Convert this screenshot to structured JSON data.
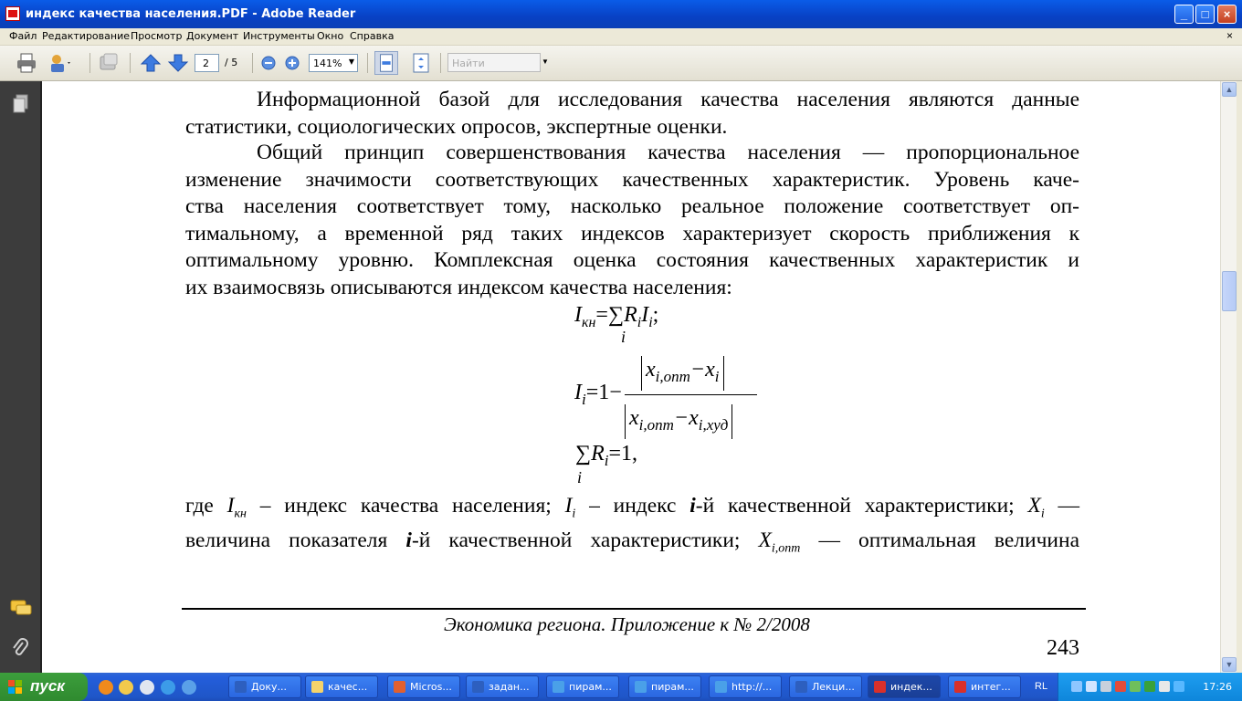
{
  "window": {
    "title": "индекс качества населения.PDF - Adobe Reader",
    "controls": {
      "minimize": "_",
      "maximize": "□",
      "close": "×"
    }
  },
  "menu": {
    "items": [
      "Файл",
      "Редактирование",
      "Просмотр",
      "Документ",
      "Инструменты",
      "Окно",
      "Справка"
    ],
    "close_doc": "×"
  },
  "toolbar": {
    "page_current": "2",
    "page_total": "/ 5",
    "zoom": "141%",
    "search_placeholder": "Найти"
  },
  "document": {
    "top_paragraph": [
      "Информационной базой для исследования качества населения являются данные",
      "статистики, социологических опросов, экспертные оценки."
    ],
    "main_paragraph": [
      "Общий принцип совершенствования качества населения — пропорциональное",
      "изменение значимости соответствующих качественных характеристик. Уровень каче-",
      "ства  населения соответствует тому, насколько реальное положение соответствует оп-",
      "тимальному, а временной ряд таких индексов характеризует скорость приближения к",
      "оптимальному уровню. Комплексная оценка состояния качественных характеристик и",
      "их взаимосвязь описываются индексом качества населения:"
    ],
    "formulas": {
      "f1_left": "I",
      "f1_left_sub": "кн",
      "f1_eq": "=",
      "f1_sum": "∑",
      "f1_sum_sub": "i",
      "f1_R": "R",
      "f1_R_sub": "i",
      "f1_I": "I",
      "f1_I_sub": "i",
      "f1_end": ";",
      "f2_left": "I",
      "f2_left_sub": "i",
      "f2_eq": "=1−",
      "f2_num": "x",
      "f2_num_sub": "i,опт",
      "f2_num_minus": "−x",
      "f2_num_minus_sub": "i",
      "f2_den": "x",
      "f2_den_sub": "i,опт",
      "f2_den_minus": "−x",
      "f2_den_minus_sub": "i,худ",
      "f3_sum": "∑",
      "f3_sum_sub": "i",
      "f3_R": "R",
      "f3_R_sub": "i",
      "f3_rest": "=1,"
    },
    "bottom_lines": {
      "l1_prefix": "где ",
      "l1_Ikn": "I",
      "l1_Ikn_sub": "кн",
      "l1_mid1": " – индекс качества  населения; ",
      "l1_Ii": "I",
      "l1_Ii_sub": "i",
      "l1_mid2": " – индекс ",
      "l1_i": "i",
      "l1_mid3": "-й качественной характеристики; ",
      "l1_Xi": "X",
      "l1_Xi_sub": "i",
      "l1_end": " —",
      "l2_a": "величина показателя ",
      "l2_i": "i",
      "l2_b": "-й качественной характеристики; ",
      "l2_X": "X",
      "l2_X_sub": "i,опт",
      "l2_c": " — оптимальная величина"
    },
    "footer": "Экономика региона. Приложение к № 2/2008",
    "page_number": "243"
  },
  "taskbar": {
    "start_label": "пуск",
    "tasks": [
      "Доку...",
      "качес...",
      "Micros...",
      "задан...",
      "пирам...",
      "пирам...",
      "http://...",
      "Лекци...",
      "индек...",
      "интег..."
    ],
    "language": "RL",
    "clock": "17:26"
  },
  "colors": {
    "titlebar": "#0841c4",
    "taskbar": "#245edb",
    "navpane": "#3c3c3c",
    "start_button": "#2f8a2f"
  }
}
